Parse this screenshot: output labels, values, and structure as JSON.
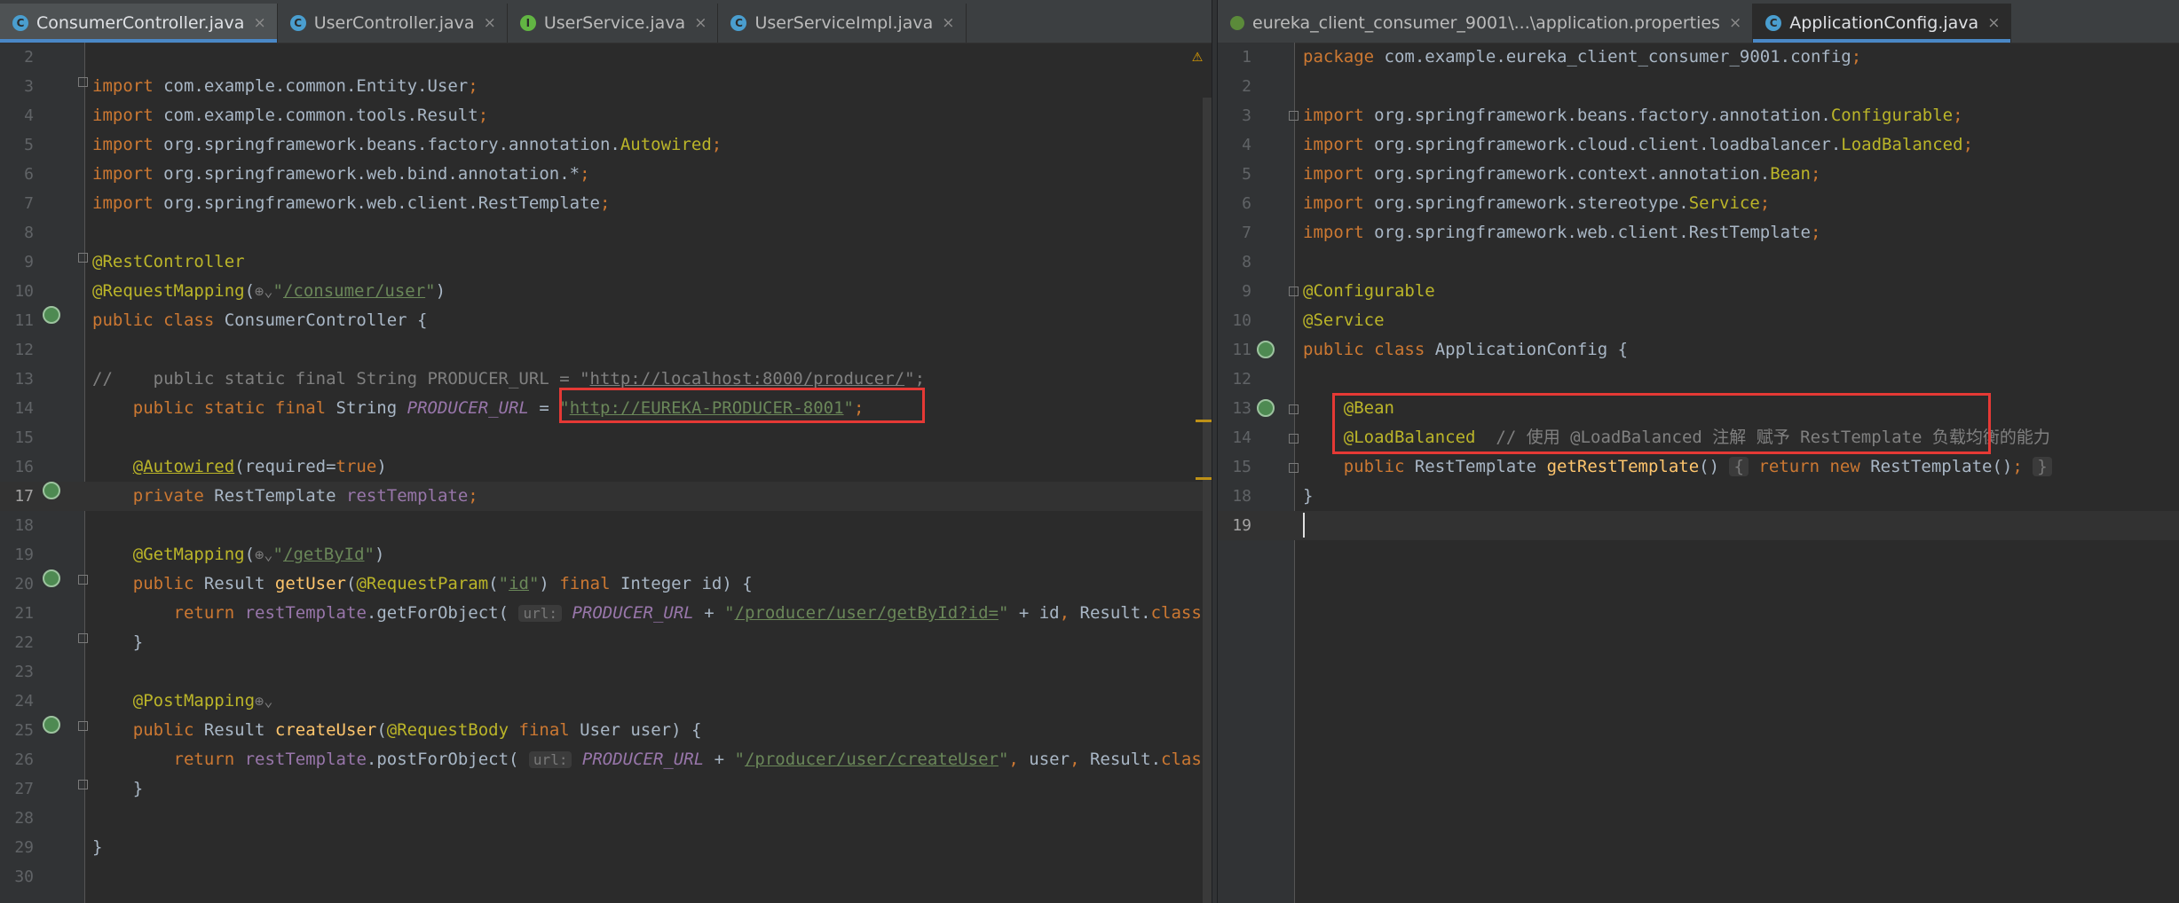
{
  "left_tabs": [
    {
      "label": "ConsumerController.java",
      "icon": "class-icon",
      "icon_letter": "C",
      "active": true
    },
    {
      "label": "UserController.java",
      "icon": "class-icon",
      "icon_letter": "C",
      "active": false
    },
    {
      "label": "UserService.java",
      "icon": "interface-icon",
      "icon_letter": "I",
      "active": false
    },
    {
      "label": "UserServiceImpl.java",
      "icon": "class-icon",
      "icon_letter": "C",
      "active": false
    }
  ],
  "right_tabs": [
    {
      "label": "eureka_client_consumer_9001\\...\\application.properties",
      "icon": "properties-icon",
      "icon_letter": "",
      "active": false
    },
    {
      "label": "ApplicationConfig.java",
      "icon": "class-icon",
      "icon_letter": "C",
      "active": true
    }
  ],
  "close_glyph": "×",
  "left_editor": {
    "lines": [
      {
        "n": "2",
        "html": ""
      },
      {
        "n": "3",
        "html": "<span class='kw'>import</span> com.example.common.Entity.User<span class='kw'>;</span>"
      },
      {
        "n": "4",
        "html": "<span class='kw'>import</span> com.example.common.tools.Result<span class='kw'>;</span>"
      },
      {
        "n": "5",
        "html": "<span class='kw'>import</span> org.springframework.beans.factory.annotation.<span class='an'>Autowired</span><span class='kw'>;</span>"
      },
      {
        "n": "6",
        "html": "<span class='kw'>import</span> org.springframework.web.bind.annotation.*<span class='kw'>;</span>"
      },
      {
        "n": "7",
        "html": "<span class='kw'>import</span> org.springframework.web.client.RestTemplate<span class='kw'>;</span>"
      },
      {
        "n": "8",
        "html": ""
      },
      {
        "n": "9",
        "html": "<span class='an'>@RestController</span>"
      },
      {
        "n": "10",
        "html": "<span class='an'>@RequestMapping</span>(<span class='glob'>⊕⌄</span><span class='st'>\"</span><span class='stu'>/consumer/user</span><span class='st'>\"</span>)"
      },
      {
        "n": "11",
        "html": "<span class='kw'>public class</span> ConsumerController {"
      },
      {
        "n": "12",
        "html": ""
      },
      {
        "n": "13",
        "html": "<span class='cm'>//    public static final String PRODUCER_URL = \"<u>http://localhost:8000/producer/</u>\";</span>"
      },
      {
        "n": "14",
        "html": "    <span class='kw'>public static final</span> String <span class='fld'>PRODUCER_URL</span> = <span class='st'>\"</span><span class='stu'>http://EUREKA-PRODUCER-8001</span><span class='st'>\"</span><span class='kw'>;</span>"
      },
      {
        "n": "15",
        "html": ""
      },
      {
        "n": "16",
        "html": "    <span class='an'><u>@Autowired</u></span>(required=<span class='kw'>true</span>)"
      },
      {
        "n": "17",
        "html": "    <span class='kw'>private</span> RestTemplate <span class='pm'>restTemplate</span><span class='kw'>;</span>"
      },
      {
        "n": "18",
        "html": ""
      },
      {
        "n": "19",
        "html": "    <span class='an'>@GetMapping</span>(<span class='glob'>⊕⌄</span><span class='st'>\"</span><span class='stu'>/getById</span><span class='st'>\"</span>)"
      },
      {
        "n": "20",
        "html": "    <span class='kw'>public</span> Result <span class='fn'>getUser</span>(<span class='an'>@RequestParam</span>(<span class='st'>\"</span><span class='stu'>id</span><span class='st'>\"</span>) <span class='kw'>final</span> Integer id) {"
      },
      {
        "n": "21",
        "html": "        <span class='kw'>return</span> <span class='pm'>restTemplate</span>.getForObject( <span class='hint'>url:</span> <span class='fld'>PRODUCER_URL</span> + <span class='st'>\"</span><span class='stu'>/producer/user/getById?id=</span><span class='st'>\"</span> + id<span class='kw'>,</span> Result.<span class='kw'>class</span>"
      },
      {
        "n": "22",
        "html": "    }"
      },
      {
        "n": "23",
        "html": ""
      },
      {
        "n": "24",
        "html": "    <span class='an'>@PostMapping</span><span class='glob'>⊕⌄</span>"
      },
      {
        "n": "25",
        "html": "    <span class='kw'>public</span> Result <span class='fn'>createUser</span>(<span class='an'>@RequestBody</span> <span class='kw'>final</span> User user) {"
      },
      {
        "n": "26",
        "html": "        <span class='kw'>return</span> <span class='pm'>restTemplate</span>.postForObject( <span class='hint'>url:</span> <span class='fld'>PRODUCER_URL</span> + <span class='st'>\"</span><span class='stu'>/producer/user/createUser</span><span class='st'>\"</span><span class='kw'>,</span> user<span class='kw'>,</span> Result.<span class='kw'>class</span>"
      },
      {
        "n": "27",
        "html": "    }"
      },
      {
        "n": "28",
        "html": ""
      },
      {
        "n": "29",
        "html": "}"
      },
      {
        "n": "30",
        "html": ""
      }
    ]
  },
  "right_editor": {
    "lines": [
      {
        "n": "1",
        "html": "<span class='kw'>package</span> com.example.eureka_client_consumer_9001.config<span class='kw'>;</span>"
      },
      {
        "n": "2",
        "html": ""
      },
      {
        "n": "3",
        "html": "<span class='kw'>import</span> org.springframework.beans.factory.annotation.<span class='an'>Configurable</span><span class='kw'>;</span>"
      },
      {
        "n": "4",
        "html": "<span class='kw'>import</span> org.springframework.cloud.client.loadbalancer.<span class='an'>LoadBalanced</span><span class='kw'>;</span>"
      },
      {
        "n": "5",
        "html": "<span class='kw'>import</span> org.springframework.context.annotation.<span class='an'>Bean</span><span class='kw'>;</span>"
      },
      {
        "n": "6",
        "html": "<span class='kw'>import</span> org.springframework.stereotype.<span class='an'>Service</span><span class='kw'>;</span>"
      },
      {
        "n": "7",
        "html": "<span class='kw'>import</span> org.springframework.web.client.RestTemplate<span class='kw'>;</span>"
      },
      {
        "n": "8",
        "html": ""
      },
      {
        "n": "9",
        "html": "<span class='an'>@Configurable</span>"
      },
      {
        "n": "10",
        "html": "<span class='an'>@Service</span>"
      },
      {
        "n": "11",
        "html": "<span class='kw'>public class</span> ApplicationConfig {"
      },
      {
        "n": "12",
        "html": ""
      },
      {
        "n": "13",
        "html": "    <span class='an'>@Bean</span>"
      },
      {
        "n": "14",
        "html": "    <span class='an'>@LoadBalanced</span>  <span class='cm'>// 使用 @LoadBalanced 注解 赋予 RestTemplate 负载均衡的能力</span>"
      },
      {
        "n": "15",
        "html": "    <span class='kw'>public</span> RestTemplate <span class='fn'>getRestTemplate</span>() <span class='hint' style='font-size:19px'>{</span> <span class='kw'>return new</span> RestTemplate()<span class='kw'>;</span> <span class='hint' style='font-size:19px'>}</span>"
      },
      {
        "n": "18",
        "html": "}"
      },
      {
        "n": "19",
        "html": ""
      }
    ]
  }
}
